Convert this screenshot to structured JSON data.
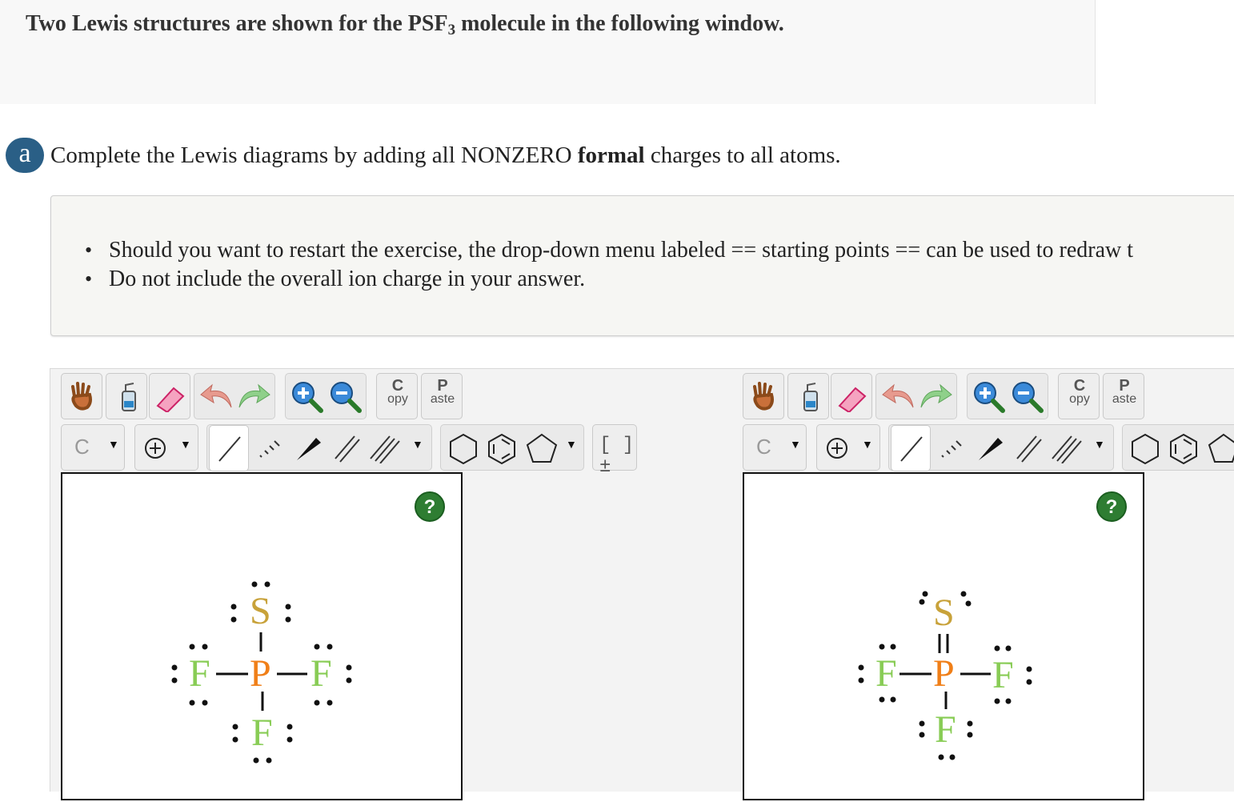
{
  "header": {
    "title_prefix": "Two Lewis structures are shown for the PSF",
    "title_sub": "3",
    "title_suffix": " molecule in the following window."
  },
  "part": {
    "badge": "a",
    "q_before": "Complete the Lewis diagrams by adding all NONZERO ",
    "q_bold": "formal",
    "q_after": " charges to all atoms."
  },
  "notes": {
    "items": [
      "Should you want to restart the exercise, the drop-down menu labeled == starting points == can be used to redraw t",
      "Do not include the overall ion charge in your answer."
    ]
  },
  "toolbar": {
    "copy_top": "C",
    "copy_bottom": "opy",
    "paste_top": "P",
    "paste_bottom": "aste",
    "atom_select": "C",
    "bracket_label": "[ ]±"
  },
  "help_label": "?",
  "lewis_left": {
    "S": "S",
    "P": "P",
    "F_left": "F",
    "F_right": "F",
    "F_bottom": "F"
  },
  "lewis_right": {
    "S": "S",
    "P": "P",
    "F_left": "F",
    "F_right": "F",
    "F_bottom": "F"
  },
  "colors": {
    "S": "#c8a23a",
    "P": "#f07f18",
    "F": "#88cc55",
    "badge": "#2a5f86",
    "help": "#2e7d32"
  },
  "icons": [
    "hand-icon",
    "eraser-bottle-icon",
    "eraser-icon",
    "undo-icon",
    "redo-icon",
    "zoom-in-icon",
    "zoom-out-icon",
    "charge-plus-icon",
    "single-bond-icon",
    "hashed-bond-icon",
    "wedge-bond-icon",
    "double-bond-icon",
    "triple-bond-icon",
    "cyclohexane-icon",
    "benzene-icon",
    "cyclopentane-icon",
    "bracket-icon"
  ]
}
